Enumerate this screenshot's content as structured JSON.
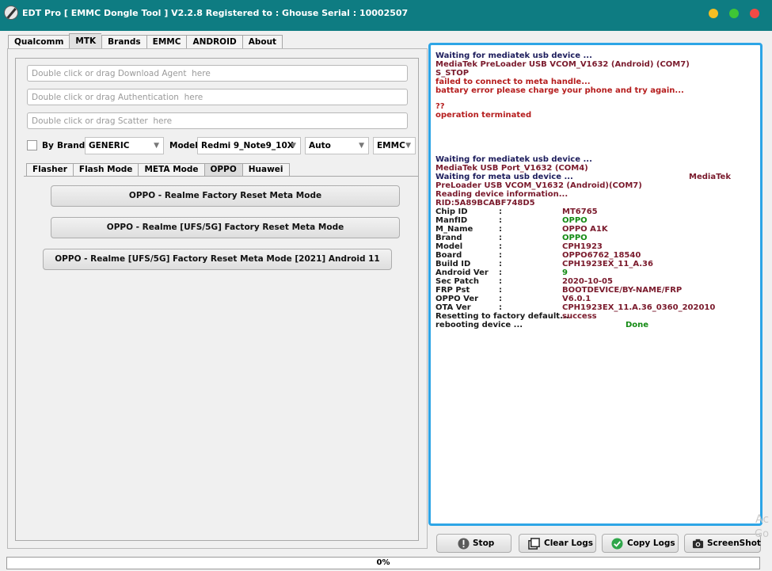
{
  "window": {
    "title": "EDT Pro  [ EMMC Dongle Tool ] V2.2.8 Registered to : Ghouse   Serial : 10002507"
  },
  "top_tabs": [
    "Qualcomm",
    "MTK",
    "Brands",
    "EMMC",
    "ANDROID",
    "About"
  ],
  "top_tab_active": "MTK",
  "fields": {
    "download_agent": "Double click or drag Download Agent  here",
    "authentication": "Double click or drag Authentication  here",
    "scatter": "Double click or drag Scatter  here"
  },
  "options": {
    "by_label": "By",
    "brand_label": "Brand",
    "brand_value": "GENERIC",
    "model_label": "Model",
    "model_value": "Redmi 9_Note9_10X",
    "mode_value": "Auto",
    "storage_value": "EMMC"
  },
  "sub_tabs": [
    "Flasher",
    "Flash Mode",
    "META Mode",
    "OPPO",
    "Huawei"
  ],
  "sub_tab_active": "OPPO",
  "actions": [
    "OPPO - Realme Factory Reset Meta Mode",
    "OPPO - Realme [UFS/5G] Factory Reset Meta Mode",
    "OPPO - Realme [UFS/5G] Factory Reset Meta Mode [2021] Android 11"
  ],
  "log": {
    "lines": [
      {
        "text": "Waiting for mediatek usb device ...",
        "color": "navy"
      },
      {
        "text": "MediaTek PreLoader USB VCOM_V1632 (Android) (COM7)",
        "color": "maroon"
      },
      {
        "text": "S_STOP",
        "color": "maroon"
      },
      {
        "text": "failed to connect to meta handle...",
        "color": "red"
      },
      {
        "text": "battary error please charge your phone and try again...",
        "color": "red"
      },
      {
        "text": "??",
        "color": "red"
      },
      {
        "text": "operation terminated",
        "color": "red"
      },
      {
        "text": "Waiting for mediatek usb device ...",
        "color": "navy"
      },
      {
        "text": "MediaTek USB Port_V1632 (COM4)",
        "color": "maroon"
      },
      {
        "text": "Waiting for meta usb device ...",
        "color": "navy",
        "extra": "MediaTek"
      },
      {
        "text": "PreLoader USB VCOM_V1632 (Android)(COM7)",
        "color": "maroon"
      },
      {
        "text": "Reading device information...",
        "color": "maroon"
      },
      {
        "text": "RID:5A89BCABF748D5",
        "color": "maroon"
      }
    ],
    "info": [
      {
        "key": "Chip ID",
        "value": "MT6765",
        "color": "maroon"
      },
      {
        "key": "ManfID",
        "value": "OPPO",
        "color": "green"
      },
      {
        "key": "M_Name",
        "value": "OPPO A1K",
        "color": "maroon"
      },
      {
        "key": "Brand",
        "value": "OPPO",
        "color": "green"
      },
      {
        "key": "Model",
        "value": "CPH1923",
        "color": "maroon"
      },
      {
        "key": "Board",
        "value": "OPPO6762_18540",
        "color": "maroon"
      },
      {
        "key": "Build ID",
        "value": "CPH1923EX_11_A.36",
        "color": "maroon"
      },
      {
        "key": "Android Ver",
        "value": "9",
        "color": "green"
      },
      {
        "key": "Sec Patch",
        "value": "2020-10-05",
        "color": "maroon"
      },
      {
        "key": "FRP Pst",
        "value": "BOOTDEVICE/BY-NAME/FRP",
        "color": "maroon"
      },
      {
        "key": "OPPO Ver",
        "value": "V6.0.1",
        "color": "maroon"
      },
      {
        "key": "OTA Ver",
        "value": "CPH1923EX_11.A.36_0360_202010",
        "color": "maroon"
      }
    ],
    "separator": ":",
    "reset_line": {
      "text": "Resetting to factory default...",
      "status": "success"
    },
    "reboot_line": {
      "text": "rebooting device ...",
      "status": "Done"
    }
  },
  "bottom_buttons": {
    "stop": "Stop",
    "clear_logs": "Clear Logs",
    "copy_logs": "Copy Logs",
    "screenshot": "ScreenShot"
  },
  "progress": {
    "label": "0%",
    "value": 0
  },
  "watermark": {
    "line1": "Ac",
    "line2": "Go"
  }
}
